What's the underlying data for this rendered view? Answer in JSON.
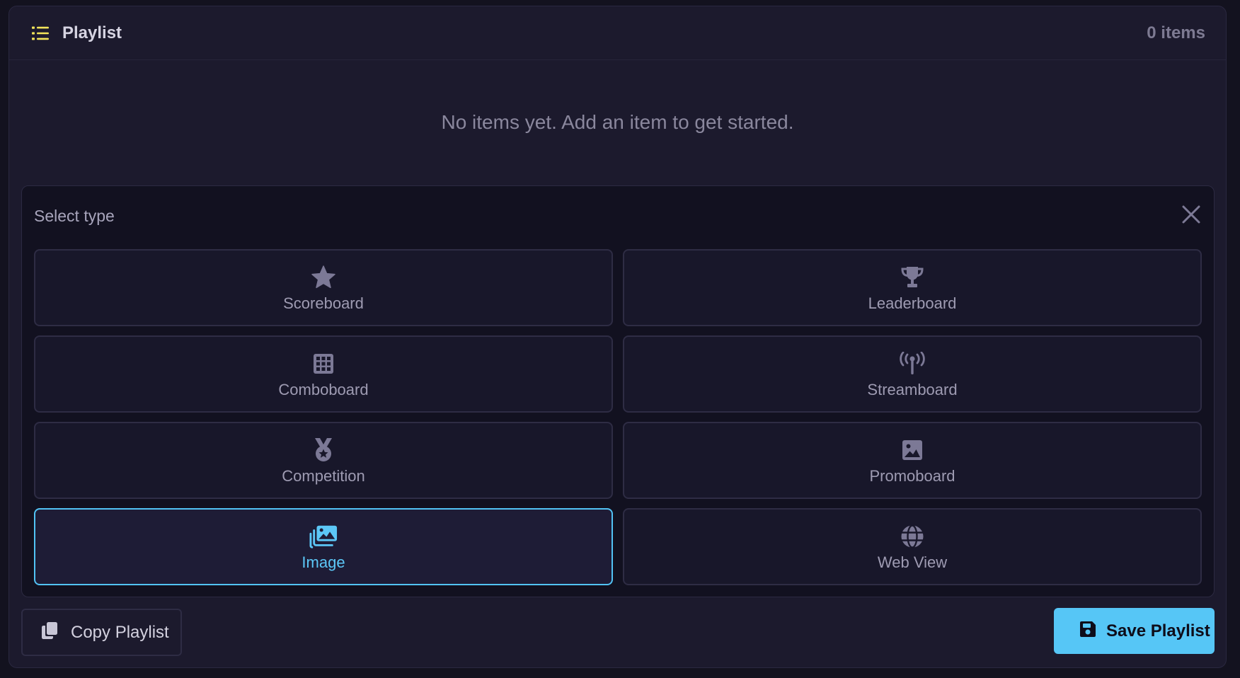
{
  "header": {
    "title": "Playlist",
    "item_count": "0 items",
    "icon": "list-icon"
  },
  "empty_state": {
    "message": "No items yet. Add an item to get started."
  },
  "type_selector": {
    "title": "Select type",
    "close_icon": "close-icon",
    "types": [
      {
        "label": "Scoreboard",
        "icon": "star-icon",
        "selected": false
      },
      {
        "label": "Leaderboard",
        "icon": "trophy-icon",
        "selected": false
      },
      {
        "label": "Comboboard",
        "icon": "grid-icon",
        "selected": false
      },
      {
        "label": "Streamboard",
        "icon": "broadcast-tower-icon",
        "selected": false
      },
      {
        "label": "Competition",
        "icon": "medal-icon",
        "selected": false
      },
      {
        "label": "Promoboard",
        "icon": "image-icon",
        "selected": false
      },
      {
        "label": "Image",
        "icon": "images-icon",
        "selected": true
      },
      {
        "label": "Web View",
        "icon": "globe-icon",
        "selected": false
      }
    ]
  },
  "footer": {
    "copy_label": "Copy Playlist",
    "copy_icon": "copy-icon",
    "save_label": "Save Playlist",
    "save_icon": "floppy-disk-icon"
  },
  "colors": {
    "accent": "#56c6f6",
    "list_icon": "#f2e45a",
    "background": "#1c1a2d"
  }
}
